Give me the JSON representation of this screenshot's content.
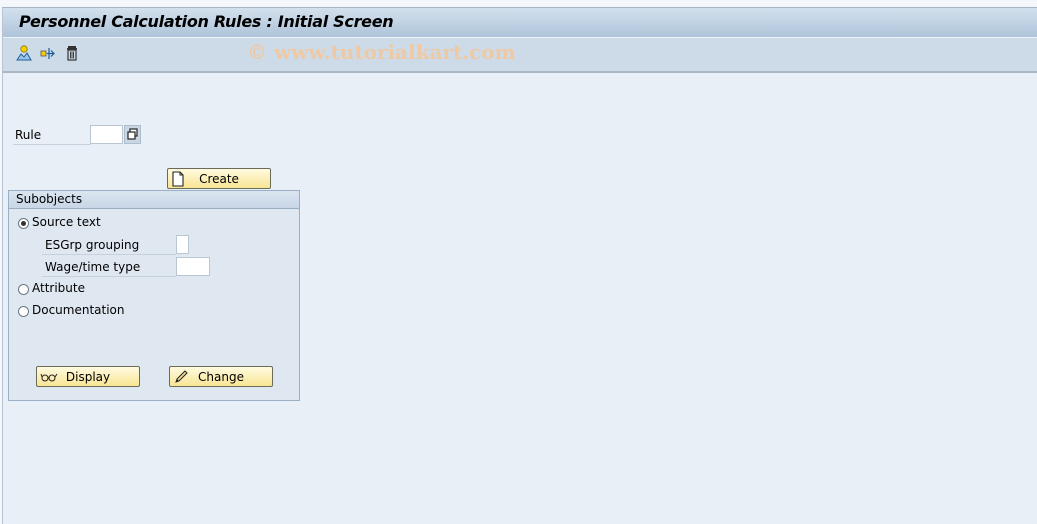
{
  "window": {
    "title": "Personnel Calculation Rules : Initial Screen",
    "watermark": "© www.tutorialkart.com"
  },
  "toolbar": {
    "icons": [
      {
        "name": "other-object-icon"
      },
      {
        "name": "transport-icon"
      },
      {
        "name": "delete-icon"
      }
    ]
  },
  "form": {
    "rule_label": "Rule",
    "rule_value": "",
    "create_label": "Create"
  },
  "subobjects": {
    "title": "Subobjects",
    "options": [
      {
        "label": "Source text",
        "selected": true
      },
      {
        "label": "Attribute",
        "selected": false
      },
      {
        "label": "Documentation",
        "selected": false
      }
    ],
    "esgrp_label": "ESGrp grouping",
    "esgrp_value": "",
    "wage_label": "Wage/time type",
    "wage_value": "",
    "display_label": "Display",
    "change_label": "Change"
  }
}
